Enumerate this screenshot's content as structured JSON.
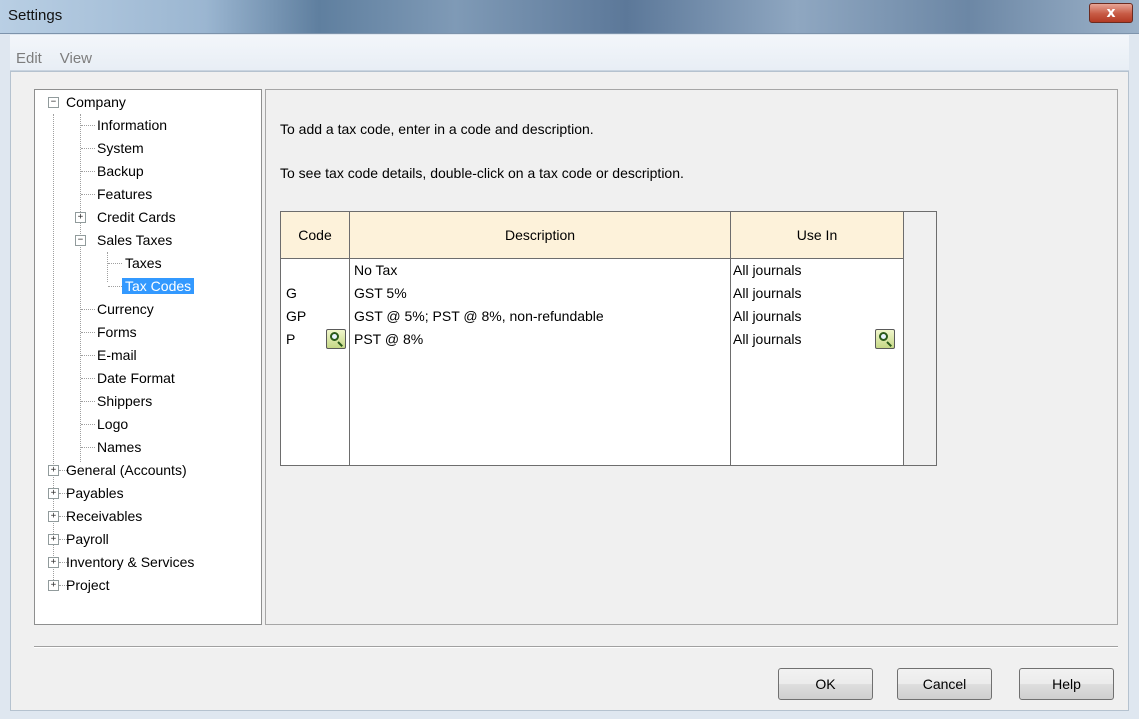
{
  "window": {
    "title": "Settings",
    "close_label": "x"
  },
  "menu": {
    "items": [
      "Edit",
      "View"
    ]
  },
  "tree": {
    "company": "Company",
    "information": "Information",
    "system": "System",
    "backup": "Backup",
    "features": "Features",
    "credit_cards": "Credit Cards",
    "sales_taxes": "Sales Taxes",
    "taxes": "Taxes",
    "tax_codes": "Tax Codes",
    "currency": "Currency",
    "forms": "Forms",
    "email": "E-mail",
    "date_format": "Date Format",
    "shippers": "Shippers",
    "logo": "Logo",
    "names": "Names",
    "general_accounts": "General (Accounts)",
    "payables": "Payables",
    "receivables": "Receivables",
    "payroll": "Payroll",
    "inventory_services": "Inventory & Services",
    "project": "Project"
  },
  "content": {
    "instruction_add": "To add a tax code, enter in a code and description.",
    "instruction_see": "To see tax code details, double-click on a tax code or description."
  },
  "table": {
    "columns": [
      "Code",
      "Description",
      "Use In"
    ],
    "rows": [
      {
        "code": "",
        "description": "No Tax",
        "use_in": "All journals"
      },
      {
        "code": "G",
        "description": "GST 5%",
        "use_in": "All journals"
      },
      {
        "code": "GP",
        "description": "GST @ 5%; PST @ 8%, non-refundable",
        "use_in": "All journals"
      },
      {
        "code": "P",
        "description": "PST @ 8%",
        "use_in": "All journals"
      }
    ]
  },
  "buttons": {
    "ok": "OK",
    "cancel": "Cancel",
    "help": "Help"
  }
}
